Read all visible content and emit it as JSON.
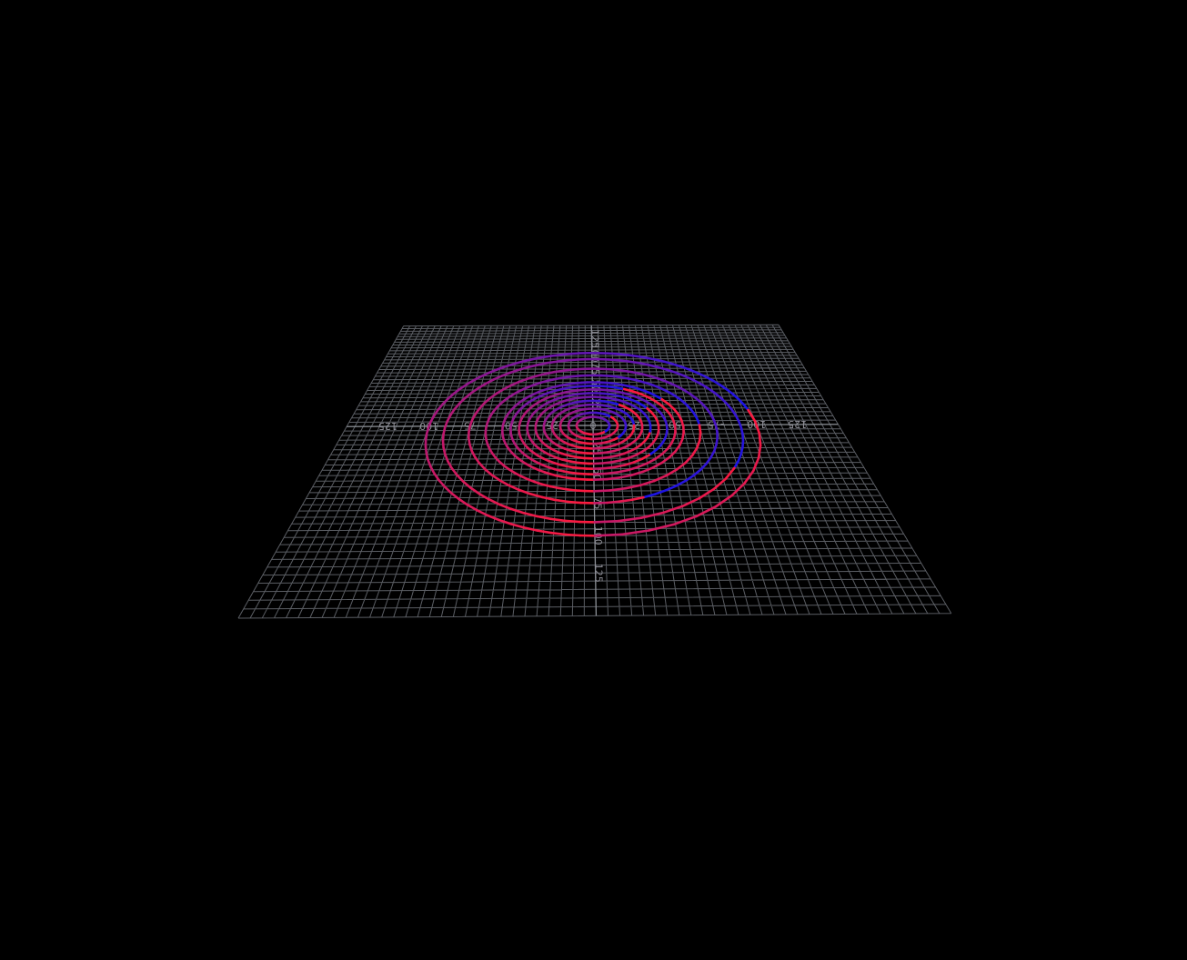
{
  "scene": {
    "background": "#000000",
    "grid_color": "#6b6f76",
    "axis_color": "#8c9096",
    "ring_color_start": "#1a14e6",
    "ring_color_end": "#ff1a3c",
    "grid_extent": [
      -150,
      150
    ],
    "grid_step": 5,
    "rings": [
      {
        "radius": 10,
        "seam_azimuth_deg": 40
      },
      {
        "radius": 15,
        "seam_azimuth_deg": 130
      },
      {
        "radius": 20,
        "seam_azimuth_deg": 45
      },
      {
        "radius": 25,
        "seam_azimuth_deg": 90
      },
      {
        "radius": 30,
        "seam_azimuth_deg": 145
      },
      {
        "radius": 35,
        "seam_azimuth_deg": 75
      },
      {
        "radius": 40,
        "seam_azimuth_deg": 120
      },
      {
        "radius": 45,
        "seam_azimuth_deg": 45
      },
      {
        "radius": 50,
        "seam_azimuth_deg": 155
      },
      {
        "radius": 55,
        "seam_azimuth_deg": 125
      },
      {
        "radius": 65,
        "seam_azimuth_deg": 90
      },
      {
        "radius": 75,
        "seam_azimuth_deg": 20
      },
      {
        "radius": 90,
        "seam_azimuth_deg": 60
      },
      {
        "radius": 100,
        "seam_azimuth_deg": 100
      }
    ]
  },
  "axes": {
    "x_ticks": [
      {
        "value": -125,
        "label": "125"
      },
      {
        "value": -100,
        "label": "100"
      },
      {
        "value": -75,
        "label": "75"
      },
      {
        "value": -50,
        "label": "50"
      },
      {
        "value": -25,
        "label": "25"
      },
      {
        "value": 0,
        "label": "0"
      },
      {
        "value": 25,
        "label": "25"
      },
      {
        "value": 50,
        "label": "50"
      },
      {
        "value": 75,
        "label": "-75"
      },
      {
        "value": 100,
        "label": "100"
      },
      {
        "value": 125,
        "label": "125"
      }
    ],
    "z_ticks": [
      {
        "value": -125,
        "label": "125"
      },
      {
        "value": -100,
        "label": "100"
      },
      {
        "value": -75,
        "label": "75"
      },
      {
        "value": -50,
        "label": "50"
      },
      {
        "value": -25,
        "label": "25"
      },
      {
        "value": 25,
        "label": "25"
      },
      {
        "value": 50,
        "label": "50"
      },
      {
        "value": 75,
        "label": "75"
      },
      {
        "value": 100,
        "label": "100"
      },
      {
        "value": 125,
        "label": "125"
      }
    ]
  }
}
